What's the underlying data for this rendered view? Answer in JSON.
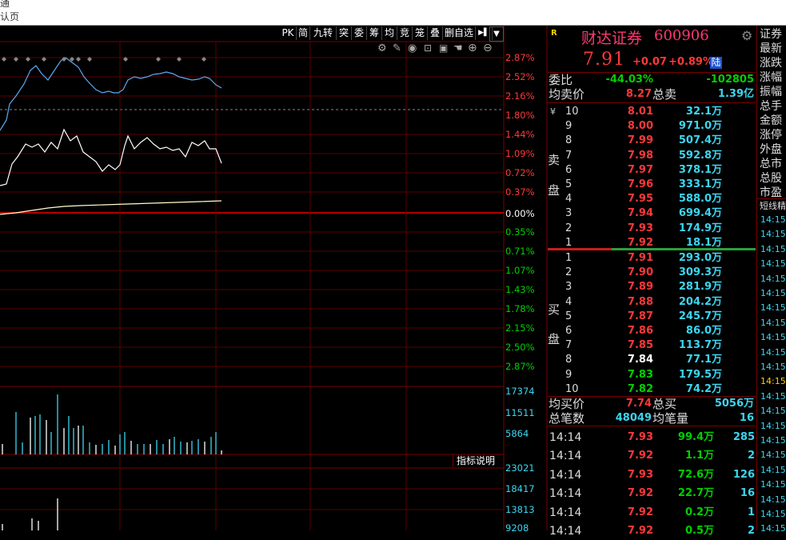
{
  "window": {
    "line1": "通",
    "line2": "认页"
  },
  "chart_toolbar": {
    "buttons": [
      "PK",
      "简",
      "九转",
      "突",
      "委",
      "筹",
      "均",
      "竞",
      "笼",
      "叠",
      "删自选"
    ],
    "arrow": "▶▌",
    "dropdown": "▼"
  },
  "price_scale": {
    "up": [
      "2.87%",
      "2.52%",
      "2.16%",
      "1.80%",
      "1.44%",
      "1.09%",
      "0.72%",
      "0.37%"
    ],
    "zero": "0.00%",
    "down": [
      "0.35%",
      "0.71%",
      "1.07%",
      "1.43%",
      "1.78%",
      "2.15%",
      "2.50%",
      "2.87%"
    ]
  },
  "volume_scale": [
    "17374",
    "11511",
    "5864"
  ],
  "indicator_scale": [
    "23021",
    "18417",
    "13813",
    "9208"
  ],
  "indicator_label": "指标说明",
  "quote": {
    "badge": "R",
    "name": "财达证券",
    "code": "600906",
    "price": "7.91",
    "change": "+0.07",
    "change_pct": "+0.89%",
    "market_tag": "陆",
    "weibi_label": "委比",
    "weibi_pct": "-44.03%",
    "weibi_diff": "-102805",
    "avg_sell_label": "均卖价",
    "avg_sell": "8.27",
    "total_sell_label": "总卖",
    "total_sell": "1.39亿",
    "avg_buy_label": "均买价",
    "avg_buy": "7.74",
    "total_buy_label": "总买",
    "total_buy": "5056万",
    "total_trades_label": "总笔数",
    "total_trades": "48049",
    "avg_trade_label": "均笔量",
    "avg_trade": "16"
  },
  "sell_side": {
    "label_top": "卖",
    "label_bottom": "盘",
    "currency": "¥",
    "levels": [
      {
        "n": "10",
        "price": "8.01",
        "vol": "32.1万"
      },
      {
        "n": "9",
        "price": "8.00",
        "vol": "971.0万"
      },
      {
        "n": "8",
        "price": "7.99",
        "vol": "507.4万"
      },
      {
        "n": "7",
        "price": "7.98",
        "vol": "592.8万"
      },
      {
        "n": "6",
        "price": "7.97",
        "vol": "378.1万"
      },
      {
        "n": "5",
        "price": "7.96",
        "vol": "333.1万"
      },
      {
        "n": "4",
        "price": "7.95",
        "vol": "588.0万"
      },
      {
        "n": "3",
        "price": "7.94",
        "vol": "699.4万"
      },
      {
        "n": "2",
        "price": "7.93",
        "vol": "174.9万"
      },
      {
        "n": "1",
        "price": "7.92",
        "vol": "18.1万"
      }
    ]
  },
  "buy_side": {
    "label_top": "买",
    "label_bottom": "盘",
    "levels": [
      {
        "n": "1",
        "price": "7.91",
        "vol": "293.0万",
        "color": "red"
      },
      {
        "n": "2",
        "price": "7.90",
        "vol": "309.3万",
        "color": "red"
      },
      {
        "n": "3",
        "price": "7.89",
        "vol": "281.9万",
        "color": "red"
      },
      {
        "n": "4",
        "price": "7.88",
        "vol": "204.2万",
        "color": "red"
      },
      {
        "n": "5",
        "price": "7.87",
        "vol": "245.7万",
        "color": "red"
      },
      {
        "n": "6",
        "price": "7.86",
        "vol": "86.0万",
        "color": "red"
      },
      {
        "n": "7",
        "price": "7.85",
        "vol": "113.7万",
        "color": "red"
      },
      {
        "n": "8",
        "price": "7.84",
        "vol": "77.1万",
        "color": "white"
      },
      {
        "n": "9",
        "price": "7.83",
        "vol": "179.5万",
        "color": "green"
      },
      {
        "n": "10",
        "price": "7.82",
        "vol": "74.2万",
        "color": "green"
      }
    ]
  },
  "ticks": [
    {
      "time": "14:14",
      "price": "7.93",
      "amt": "99.4万",
      "n": "285",
      "pc": "red"
    },
    {
      "time": "14:14",
      "price": "7.92",
      "amt": "1.1万",
      "n": "2",
      "pc": "red"
    },
    {
      "time": "14:14",
      "price": "7.93",
      "amt": "72.6万",
      "n": "126",
      "pc": "red"
    },
    {
      "time": "14:14",
      "price": "7.92",
      "amt": "22.7万",
      "n": "16",
      "pc": "red"
    },
    {
      "time": "14:14",
      "price": "7.92",
      "amt": "0.2万",
      "n": "1",
      "pc": "red"
    },
    {
      "time": "14:14",
      "price": "7.92",
      "amt": "0.5万",
      "n": "2",
      "pc": "red"
    }
  ],
  "far_right": {
    "labels": [
      "证券",
      "最新",
      "涨跌",
      "涨幅",
      "振幅",
      "总手",
      "金额",
      "涨停",
      "外盘",
      "总市",
      "总股",
      "市盈"
    ],
    "section": "短线精",
    "times": [
      "14:15",
      "14:15",
      "14:15",
      "14:15",
      "14:15",
      "14:15",
      "14:15",
      "14:15",
      "14:15",
      "14:15",
      "14:15",
      "14:15",
      "14:15",
      "14:15",
      "14:15",
      "14:15",
      "14:15",
      "14:15",
      "14:15",
      "14:15",
      "14:15",
      "14:15"
    ]
  },
  "colors": {
    "up": "#ff3838",
    "down": "#00d000",
    "grid": "#7a0000",
    "price_line": "#5aaaf0",
    "avg_line": "#ffffcc"
  }
}
